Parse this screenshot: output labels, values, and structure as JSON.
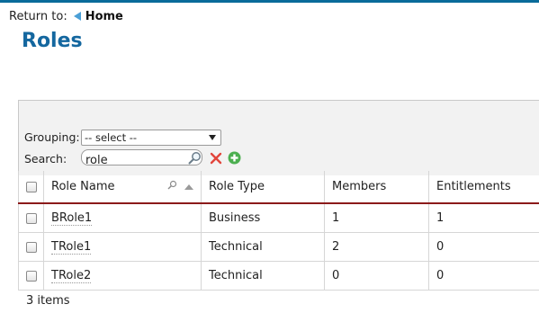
{
  "breadcrumb": {
    "prefix": "Return to:",
    "link": "Home"
  },
  "page": {
    "title": "Roles"
  },
  "filters": {
    "grouping_label": "Grouping:",
    "grouping_value": "-- select --",
    "search_label": "Search:",
    "search_value": "role",
    "icons": [
      "search-icon",
      "clear-icon",
      "add-icon"
    ]
  },
  "table": {
    "columns": [
      "Role Name",
      "Role Type",
      "Members",
      "Entitlements"
    ],
    "rows": [
      {
        "name": "BRole1",
        "type": "Business",
        "members": "1",
        "entitlements": "1"
      },
      {
        "name": "TRole1",
        "type": "Technical",
        "members": "2",
        "entitlements": "0"
      },
      {
        "name": "TRole2",
        "type": "Technical",
        "members": "0",
        "entitlements": "0"
      }
    ],
    "sort": {
      "column": "Role Name",
      "direction": "ascending"
    }
  },
  "footer": {
    "count": "3 items"
  },
  "colors": {
    "title": "#14679f",
    "header_rule": "#8b1a1a",
    "topbar": "#0a6b9a",
    "add": "#4caf50",
    "clear": "#e2453c"
  }
}
